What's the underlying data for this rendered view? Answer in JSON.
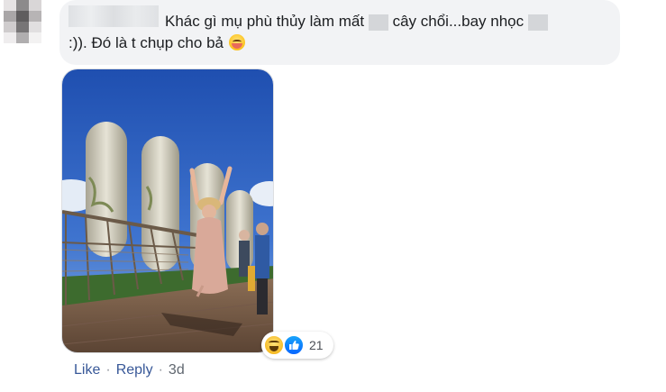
{
  "comment": {
    "text_line1": "Khác gì mụ phù thủy làm mất",
    "text_line1_b": "cây chổi...bay nhọc",
    "text_line2": ":)). Đó là t chụp cho bả",
    "emoji": "hugging-face-emoji"
  },
  "reactions": {
    "types": [
      "haha",
      "like"
    ],
    "count": "21"
  },
  "actions": {
    "like_label": "Like",
    "reply_label": "Reply",
    "separator": "·",
    "time": "3d"
  },
  "colors": {
    "bubble": "#f2f3f5",
    "link": "#385898",
    "sky": "#2a5cb8"
  }
}
